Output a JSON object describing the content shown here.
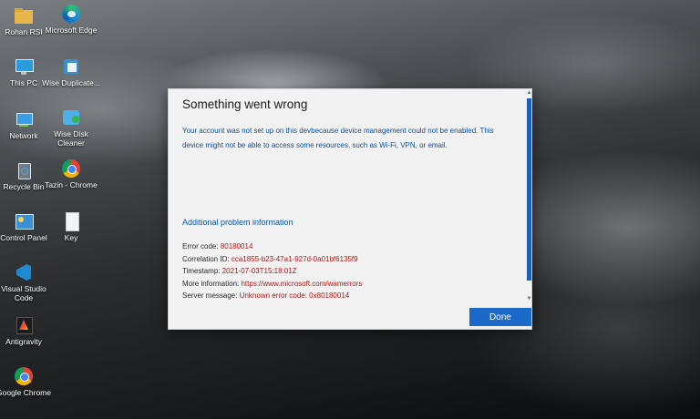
{
  "desktop": {
    "icons": [
      {
        "label": "Rohan RSI",
        "icon": "folder-icon"
      },
      {
        "label": "Microsoft Edge",
        "icon": "edge-icon"
      },
      {
        "label": "This PC",
        "icon": "monitor-icon"
      },
      {
        "label": "Wise Duplicate...",
        "icon": "wise-duplicate-icon"
      },
      {
        "label": "Network",
        "icon": "network-icon"
      },
      {
        "label": "Wise Disk Cleaner",
        "icon": "wise-disk-cleaner-icon"
      },
      {
        "label": "Recycle Bin",
        "icon": "recycle-bin-icon"
      },
      {
        "label": "Tazin - Chrome",
        "icon": "chrome-icon"
      },
      {
        "label": "Control Panel",
        "icon": "control-panel-icon"
      },
      {
        "label": "Key",
        "icon": "document-icon"
      },
      {
        "label": "Visual Studio Code",
        "icon": "vscode-icon"
      },
      {
        "label": "Antigravity",
        "icon": "antigravity-icon"
      },
      {
        "label": "Google Chrome",
        "icon": "chrome-icon"
      }
    ]
  },
  "dialog": {
    "title": "Something went wrong",
    "message_line1": "Your account was not set up on this devbecause device management could not be enabled. This",
    "message_line2": "device might not be able to access some resources, such as Wi-Fi, VPN, or email.",
    "subheading": "Additional problem information",
    "info": [
      {
        "label": "Error code:",
        "value": "80180014"
      },
      {
        "label": "Correlation ID:",
        "value": "cca1855-b23-47a1-927d-0a01bf6135f9"
      },
      {
        "label": "Timestamp:",
        "value": "2021-07-03T15:18:01Z"
      },
      {
        "label": "More information:",
        "value": "https://www.microsoft.com/wamerrors"
      },
      {
        "label": "Server message:",
        "value": "Unknown error code: 0x80180014"
      }
    ],
    "done_label": "Done"
  },
  "colors": {
    "link_blue": "#0e56a6",
    "error_red": "#b01818",
    "button_blue": "#1b6ac9"
  }
}
